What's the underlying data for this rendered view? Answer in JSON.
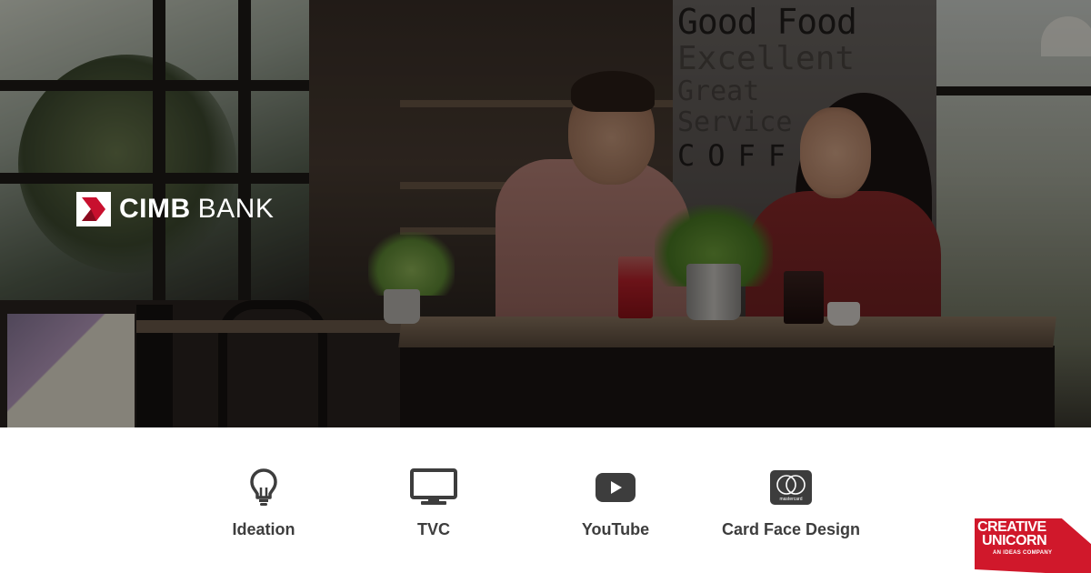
{
  "hero": {
    "wall_text_lines": [
      "Good Food",
      "Excellent",
      "Great Service",
      "COFFEE"
    ]
  },
  "brand": {
    "name_bold": "CIMB",
    "name_light": "BANK",
    "accent_color": "#c8102e"
  },
  "services": [
    {
      "label": "Ideation",
      "icon": "lightbulb-icon"
    },
    {
      "label": "TVC",
      "icon": "monitor-icon"
    },
    {
      "label": "YouTube",
      "icon": "youtube-icon"
    },
    {
      "label": "Card Face Design",
      "icon": "mastercard-icon",
      "icon_text": "mastercard"
    }
  ],
  "agency": {
    "line1": "CREATIVE",
    "line2": "UNICORN",
    "tagline": "AN IDEAS COMPANY",
    "color": "#d0182b"
  }
}
